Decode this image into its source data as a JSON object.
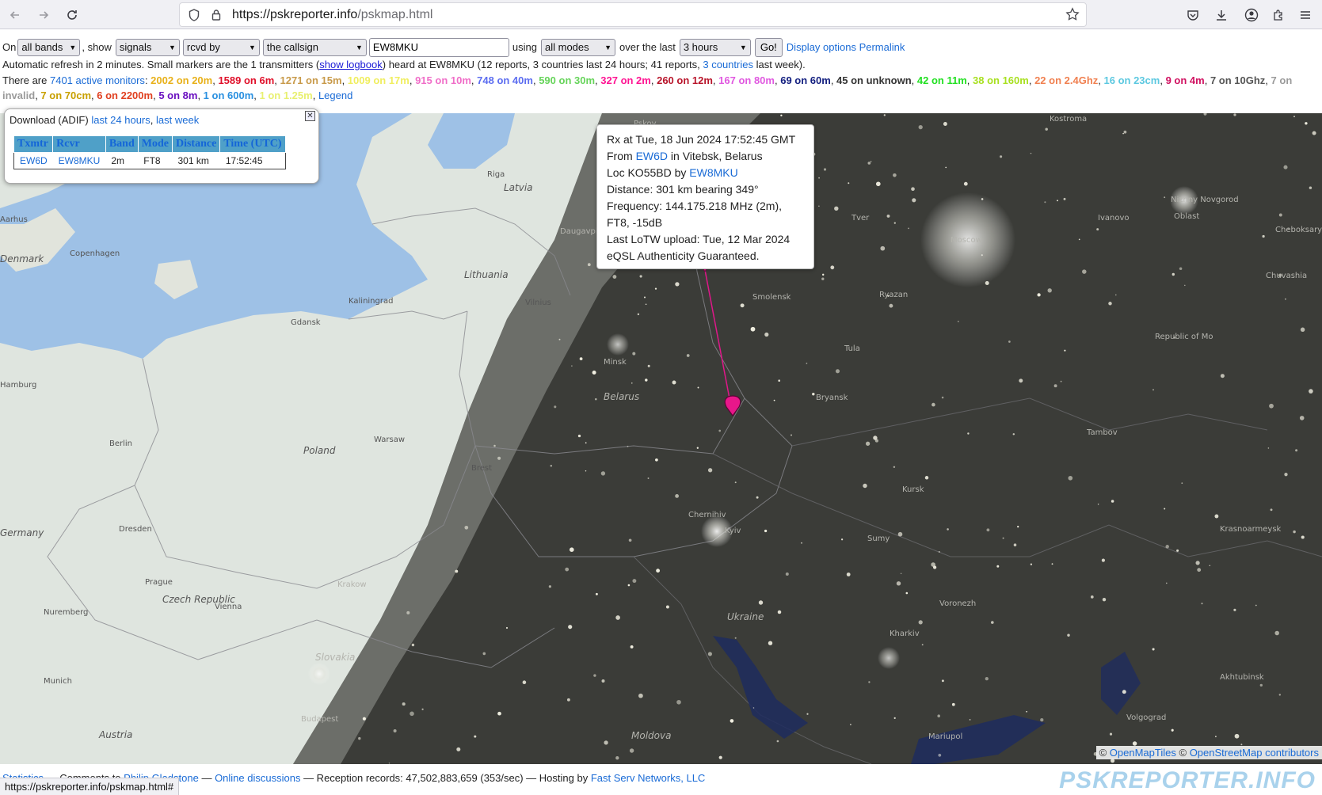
{
  "browser": {
    "url_domain": "https://pskreporter.info",
    "url_path": "/pskmap.html"
  },
  "controls": {
    "on_label": "On",
    "bands_value": "all bands",
    "show_label": ", show",
    "show_value": "signals",
    "direction_value": "rcvd by",
    "target_value": "the callsign",
    "callsign_value": "EW8MKU",
    "using_label": "using",
    "modes_value": "all modes",
    "over_label": "over the last",
    "period_value": "3 hours",
    "go_label": "Go!",
    "display_options": "Display options",
    "permalink": "Permalink"
  },
  "info1": {
    "text_a": "Automatic refresh in 2 minutes. Small markers are the 1 transmitters (",
    "show_logbook": "show logbook",
    "text_b": ") heard at EW8MKU (12 reports, 3 countries last 24 hours; 41 reports, ",
    "countries_link": "3 countries",
    "text_c": " last week)."
  },
  "info2": {
    "prefix": "There are ",
    "active_monitors": "7401 active monitors",
    "colon": ": ",
    "bands": [
      {
        "text": "2002 on 20m",
        "color": "#e8b11a"
      },
      {
        "text": "1589 on 6m",
        "color": "#e0102a"
      },
      {
        "text": "1271 on 15m",
        "color": "#c89a4a"
      },
      {
        "text": "1009 on 17m",
        "color": "#f0ee60"
      },
      {
        "text": "915 on 10m",
        "color": "#f06ec8"
      },
      {
        "text": "748 on 40m",
        "color": "#5c6df0"
      },
      {
        "text": "590 on 30m",
        "color": "#66d45a"
      },
      {
        "text": "327 on 2m",
        "color": "#ff1493"
      },
      {
        "text": "260 on 12m",
        "color": "#b8142a"
      },
      {
        "text": "167 on 80m",
        "color": "#e058e0"
      },
      {
        "text": "69 on 60m",
        "color": "#142080"
      },
      {
        "text": "45 on unknown",
        "color": "#333333"
      },
      {
        "text": "42 on 11m",
        "color": "#22e022"
      },
      {
        "text": "38 on 160m",
        "color": "#a8e020"
      },
      {
        "text": "22 on 2.4Ghz",
        "color": "#f08050"
      },
      {
        "text": "16 on 23cm",
        "color": "#5cc8e0"
      },
      {
        "text": "9 on 4m",
        "color": "#d01060"
      },
      {
        "text": "7 on 10Ghz",
        "color": "#555555"
      },
      {
        "text": "7 on invalid",
        "color": "#9a9a9a"
      },
      {
        "text": "7 on 70cm",
        "color": "#c8a000"
      },
      {
        "text": "6 on 2200m",
        "color": "#e04020"
      },
      {
        "text": "5 on 8m",
        "color": "#6a10c0"
      },
      {
        "text": "1 on 600m",
        "color": "#2a90e0"
      },
      {
        "text": "1 on 1.25m",
        "color": "#e8f070"
      }
    ],
    "legend": "Legend"
  },
  "download": {
    "label": "Download (ADIF)",
    "last24": "last 24 hours",
    "lastweek": "last week",
    "columns": [
      "Txmtr",
      "Rcvr",
      "Band",
      "Mode",
      "Distance",
      "Time (UTC)"
    ],
    "rows": [
      {
        "txmtr": "EW6D",
        "rcvr": "EW8MKU",
        "band": "2m",
        "mode": "FT8",
        "distance": "301 km",
        "time": "17:52:45"
      }
    ]
  },
  "popup": {
    "line1": "Rx at Tue, 18 Jun 2024 17:52:45 GMT",
    "from_label": "From ",
    "from_call": "EW6D",
    "from_loc": " in Vitebsk, Belarus",
    "loc_label": "Loc KO55BD by ",
    "loc_call": "EW8MKU",
    "distance": "Distance: 301 km bearing 349°",
    "frequency": "Frequency: 144.175.218 MHz (2m),",
    "mode": "FT8, -15dB",
    "lotw": "Last LoTW upload: Tue, 12 Mar 2024",
    "eqsl": "eQSL Authenticity Guaranteed."
  },
  "map_labels": [
    "Pskov",
    "Riga",
    "Latvia",
    "Lithuania",
    "Kaliningrad",
    "Vilnius",
    "Daugavpils",
    "Gdansk",
    "Copenhagen",
    "Denmark",
    "Aarhus",
    "Minsk",
    "Belarus",
    "Smolensk",
    "Moscow",
    "Berlin",
    "Poland",
    "Warsaw",
    "Brest",
    "Germany",
    "Dresden",
    "Prague",
    "Czech Republic",
    "Krakow",
    "Slovakia",
    "Vienna",
    "Munich",
    "Nuremberg",
    "Austria",
    "Budapest",
    "Moldova",
    "Ukraine",
    "Chernihiv",
    "Kyiv",
    "Kursk",
    "Sumy",
    "Kharkiv",
    "Bryansk",
    "Tula",
    "Tambov",
    "Voronezh",
    "Tver",
    "Ivanovo",
    "Kostroma",
    "Nizhny Novgorod",
    "Oblast",
    "Chuvashia",
    "Republic of Mo",
    "Cheboksary",
    "Krasnoarmeysk",
    "Akhtubinsk",
    "Volgograd",
    "Mariupol",
    "Hamburg",
    "Ryazan"
  ],
  "attribution": {
    "prefix": "©",
    "omt": "OpenMapTiles",
    "osm": "OpenStreetMap contributors"
  },
  "footer": {
    "statistics": "Statistics",
    "comments": " — Comments to ",
    "philip": "Philip Gladstone",
    "sep1": " — ",
    "online": "Online discussions",
    "records": " — Reception records: 47,502,883,659 (353/sec) — Hosting by ",
    "hosting": "Fast Serv Networks, LLC",
    "brand": "PSKREPORTER.INFO"
  },
  "status_url": "https://pskreporter.info/pskmap.html#"
}
